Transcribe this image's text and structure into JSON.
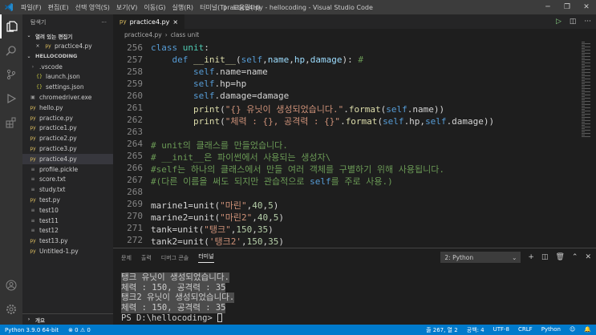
{
  "window": {
    "title": "practice4.py - hellocoding - Visual Studio Code",
    "menu": [
      "파일(F)",
      "편집(E)",
      "선택 영역(S)",
      "보기(V)",
      "이동(G)",
      "실행(R)",
      "터미널(T)",
      "도움말(H)"
    ]
  },
  "sidebar": {
    "header": "탐색기",
    "open_editors_label": "열려 있는 편집기",
    "open_editor_file": "practice4.py",
    "folder_label": "HELLOCODING",
    "tree": [
      {
        "label": ".vscode",
        "icon": "›",
        "indent": 1
      },
      {
        "label": "launch.json",
        "icon": "{}",
        "indent": 2
      },
      {
        "label": "settings.json",
        "icon": "{}",
        "indent": 2
      },
      {
        "label": "chromedriver.exe",
        "icon": "▣",
        "indent": 1
      },
      {
        "label": "hello.py",
        "icon": "py",
        "indent": 1
      },
      {
        "label": "practice.py",
        "icon": "py",
        "indent": 1
      },
      {
        "label": "practice1.py",
        "icon": "py",
        "indent": 1
      },
      {
        "label": "practice2.py",
        "icon": "py",
        "indent": 1
      },
      {
        "label": "practice3.py",
        "icon": "py",
        "indent": 1
      },
      {
        "label": "practice4.py",
        "icon": "py",
        "indent": 1,
        "selected": true
      },
      {
        "label": "profile.pickle",
        "icon": "≡",
        "indent": 1
      },
      {
        "label": "score.txt",
        "icon": "≡",
        "indent": 1
      },
      {
        "label": "study.txt",
        "icon": "≡",
        "indent": 1
      },
      {
        "label": "test.py",
        "icon": "py",
        "indent": 1
      },
      {
        "label": "test10",
        "icon": "≡",
        "indent": 1
      },
      {
        "label": "test11",
        "icon": "≡",
        "indent": 1
      },
      {
        "label": "test12",
        "icon": "≡",
        "indent": 1
      },
      {
        "label": "test13.py",
        "icon": "py",
        "indent": 1
      },
      {
        "label": "Untitled-1.py",
        "icon": "py",
        "indent": 1
      }
    ],
    "outline_label": "개요"
  },
  "tab": {
    "label": "practice4.py",
    "close": "×"
  },
  "breadcrumb": [
    "practice4.py",
    "class unit"
  ],
  "editor": {
    "lines": [
      {
        "n": "256",
        "tokens": [
          [
            "kw",
            "class "
          ],
          [
            "cl",
            "unit"
          ],
          [
            "",
            ":"
          ]
        ]
      },
      {
        "n": "257",
        "tokens": [
          [
            "",
            "    "
          ],
          [
            "kw",
            "def "
          ],
          [
            "fn",
            "__init__"
          ],
          [
            "",
            "("
          ],
          [
            "self",
            "self"
          ],
          [
            "",
            ","
          ],
          [
            "par",
            "name"
          ],
          [
            "",
            ","
          ],
          [
            "par",
            "hp"
          ],
          [
            "",
            ","
          ],
          [
            "par",
            "damage"
          ],
          [
            "",
            "): "
          ],
          [
            "cm",
            "#"
          ]
        ]
      },
      {
        "n": "258",
        "tokens": [
          [
            "",
            "        "
          ],
          [
            "self",
            "self"
          ],
          [
            "",
            ".name=name"
          ]
        ]
      },
      {
        "n": "259",
        "tokens": [
          [
            "",
            "        "
          ],
          [
            "self",
            "self"
          ],
          [
            "",
            ".hp=hp"
          ]
        ]
      },
      {
        "n": "260",
        "tokens": [
          [
            "",
            "        "
          ],
          [
            "self",
            "self"
          ],
          [
            "",
            ".damage=damage"
          ]
        ]
      },
      {
        "n": "261",
        "tokens": [
          [
            "",
            "        "
          ],
          [
            "fn",
            "print"
          ],
          [
            "",
            "("
          ],
          [
            "str",
            "\"{} 유닛이 생성되었습니다.\""
          ],
          [
            "",
            "."
          ],
          [
            "fn",
            "format"
          ],
          [
            "",
            "("
          ],
          [
            "self",
            "self"
          ],
          [
            "",
            ".name))"
          ]
        ]
      },
      {
        "n": "262",
        "tokens": [
          [
            "",
            "        "
          ],
          [
            "fn",
            "print"
          ],
          [
            "",
            "("
          ],
          [
            "str",
            "\"체력 : {}, 공격력 : {}\""
          ],
          [
            "",
            "."
          ],
          [
            "fn",
            "format"
          ],
          [
            "",
            "("
          ],
          [
            "self",
            "self"
          ],
          [
            "",
            ".hp,"
          ],
          [
            "self",
            "self"
          ],
          [
            "",
            ".damage))"
          ]
        ]
      },
      {
        "n": "263",
        "tokens": []
      },
      {
        "n": "264",
        "tokens": [
          [
            "cm",
            "# unit의 클래스를 만들었습니다."
          ]
        ]
      },
      {
        "n": "265",
        "tokens": [
          [
            "cm",
            "# __init__은 파이썬에서 사용되는 생성자\\"
          ]
        ]
      },
      {
        "n": "266",
        "tokens": [
          [
            "cm",
            "#self는 하나의 클래스에서 만들 여러 객체를 구별하기 위해 사용됩니다."
          ]
        ]
      },
      {
        "n": "267",
        "tokens": [
          [
            "cm",
            "#(다른 이름을 써도 되지만 관습적으로 "
          ],
          [
            "self",
            "self"
          ],
          [
            "cm",
            "를 주로 사용.)"
          ]
        ]
      },
      {
        "n": "268",
        "tokens": []
      },
      {
        "n": "269",
        "tokens": [
          [
            "",
            "marine1=unit("
          ],
          [
            "str",
            "\"마린\""
          ],
          [
            "",
            ","
          ],
          [
            "num",
            "40"
          ],
          [
            "",
            ","
          ],
          [
            "num",
            "5"
          ],
          [
            "",
            ")"
          ]
        ]
      },
      {
        "n": "270",
        "tokens": [
          [
            "",
            "marine2=unit("
          ],
          [
            "str",
            "\"마린2\""
          ],
          [
            "",
            ","
          ],
          [
            "num",
            "40"
          ],
          [
            "",
            ","
          ],
          [
            "num",
            "5"
          ],
          [
            "",
            ")"
          ]
        ]
      },
      {
        "n": "271",
        "tokens": [
          [
            "",
            "tank=unit("
          ],
          [
            "str",
            "\"탱크\""
          ],
          [
            "",
            ","
          ],
          [
            "num",
            "150"
          ],
          [
            "",
            ","
          ],
          [
            "num",
            "35"
          ],
          [
            "",
            ")"
          ]
        ]
      },
      {
        "n": "272",
        "tokens": [
          [
            "",
            "tank2=unit("
          ],
          [
            "str",
            "'탱크2'"
          ],
          [
            "",
            ","
          ],
          [
            "num",
            "150"
          ],
          [
            "",
            ","
          ],
          [
            "num",
            "35"
          ],
          [
            "",
            ")"
          ]
        ]
      }
    ]
  },
  "panel": {
    "tabs": [
      "문제",
      "출력",
      "디버그 콘솔",
      "터미널"
    ],
    "active_tab": "터미널",
    "terminal_select": "2: Python",
    "terminal_lines": [
      "탱크 유닛이 생성되었습니다.",
      "체력 : 150, 공격력 : 35",
      "탱크2 유닛이 생성되었습니다.",
      "체력 : 150, 공격력 : 35"
    ],
    "prompt": "PS D:\\hellocoding> "
  },
  "status": {
    "python": "Python 3.9.0 64-bit",
    "problems": "⊗ 0 ⚠ 0",
    "position": "줄 267, 열 2",
    "spaces": "공백: 4",
    "encoding": "UTF-8",
    "eol": "CRLF",
    "language": "Python"
  }
}
